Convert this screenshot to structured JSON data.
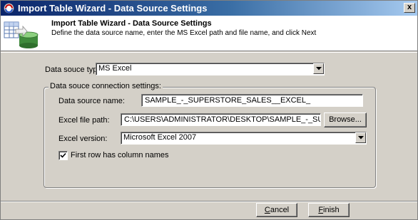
{
  "window": {
    "title": "Import Table Wizard - Data Source Settings",
    "close_glyph": "x"
  },
  "banner": {
    "title": "Import Table Wizard - Data Source Settings",
    "description": "Define the data source name, enter the MS Excel path and file name, and click Next"
  },
  "form": {
    "source_type_label": "Data souce type:",
    "source_type_value": "MS Excel",
    "group_label": "Data souce connection settings:",
    "source_name_label": "Data source name:",
    "source_name_value": "SAMPLE_-_SUPERSTORE_SALES__EXCEL_",
    "file_path_label": "Excel file path:",
    "file_path_value": "C:\\USERS\\ADMINISTRATOR\\DESKTOP\\SAMPLE_-_SUPERSTORE_SALES_(EXCEL).XLS",
    "browse_label": "Browse...",
    "excel_version_label": "Excel version:",
    "excel_version_value": "Microsoft Excel 2007",
    "first_row_label": "First row has column names",
    "first_row_checked": true
  },
  "footer": {
    "cancel_mnemonic": "C",
    "cancel_rest": "ancel",
    "finish_mnemonic": "F",
    "finish_rest": "inish"
  },
  "colors": {
    "title_bar_start": "#0a246a",
    "title_bar_end": "#a6caf0",
    "dialog_face": "#d4d0c8"
  }
}
